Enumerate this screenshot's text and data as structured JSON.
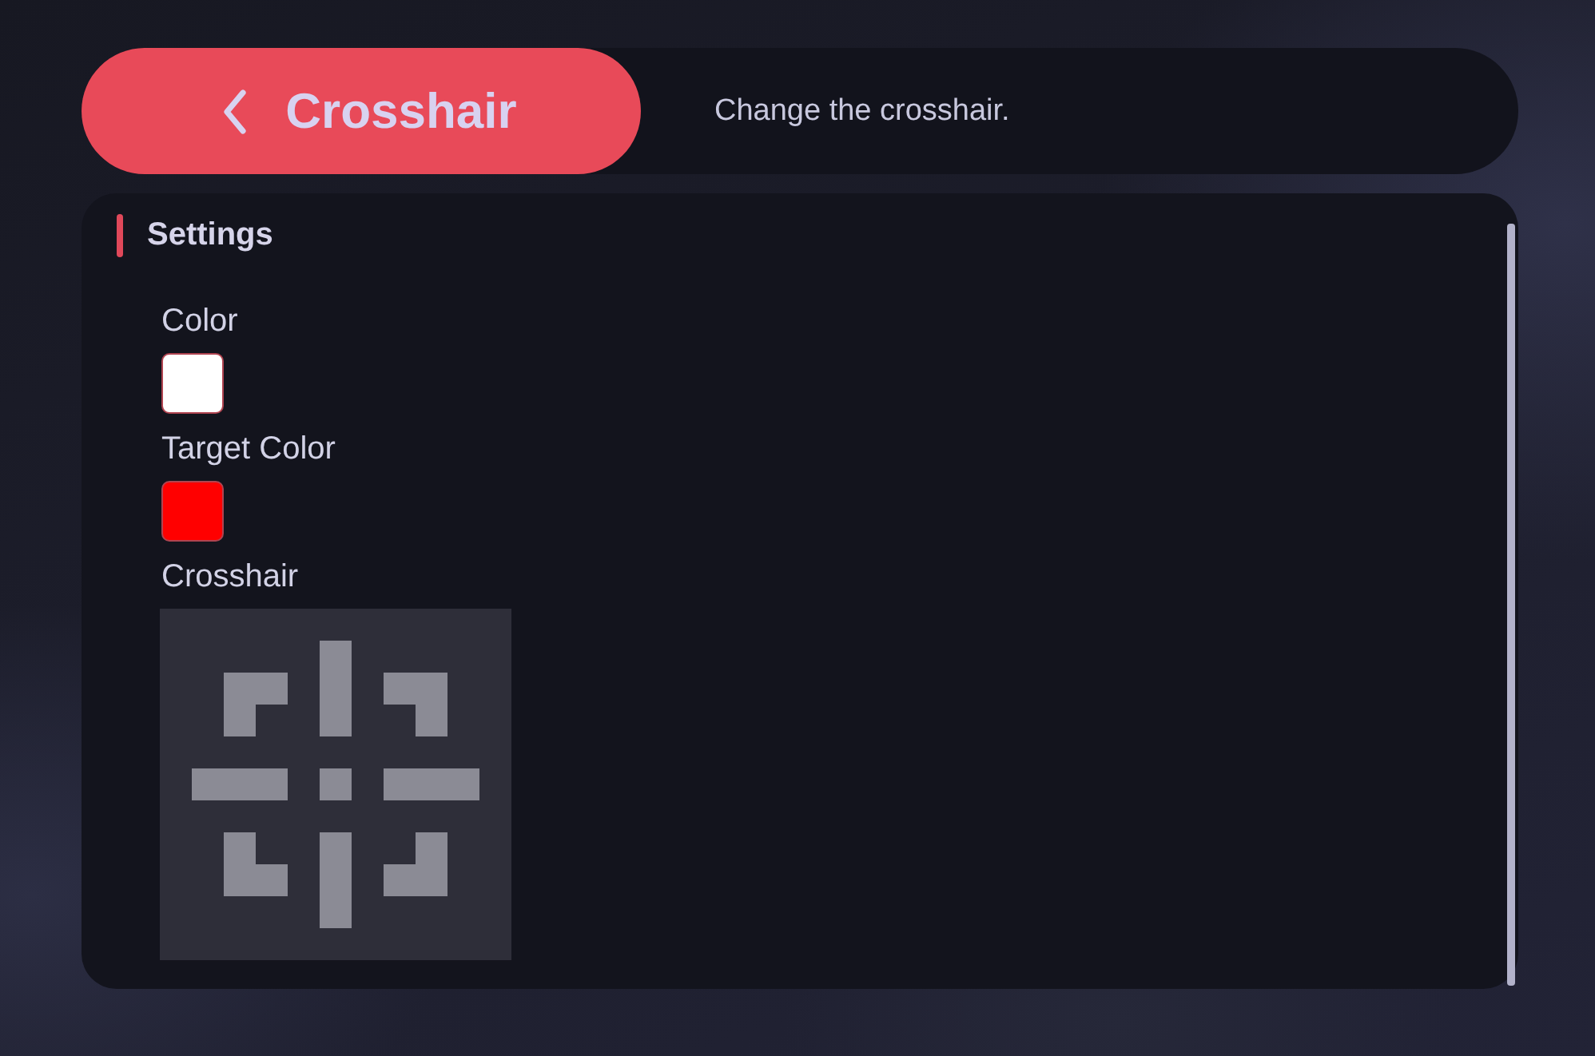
{
  "back_button": {
    "label": "Crosshair"
  },
  "description": "Change the crosshair.",
  "section": {
    "title": "Settings"
  },
  "settings": [
    {
      "kind": "color",
      "label": "Color",
      "color": "#ffffff"
    },
    {
      "kind": "color",
      "label": "Target Color",
      "color": "#ff0000"
    },
    {
      "kind": "crosshair",
      "label": "Crosshair"
    }
  ]
}
